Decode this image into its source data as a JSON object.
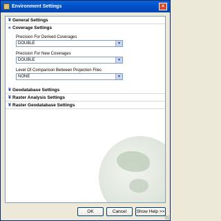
{
  "window": {
    "title": "Environment Settings",
    "close_glyph": "×"
  },
  "sections": [
    {
      "label": "General Settings",
      "expanded": false,
      "icon": "chevron-double-down-icon"
    },
    {
      "label": "Coverage Settings",
      "expanded": true,
      "icon": "chevron-double-up-icon"
    },
    {
      "label": "Geodatabase Settings",
      "expanded": false,
      "icon": "chevron-double-down-icon"
    },
    {
      "label": "Raster Analysis Settings",
      "expanded": false,
      "icon": "chevron-double-down-icon"
    },
    {
      "label": "Raster Geodatabase Settings",
      "expanded": false,
      "icon": "chevron-double-down-icon"
    }
  ],
  "coverage": {
    "precision_derived": {
      "label": "Precision For Derived Coverages",
      "value": "DOUBLE"
    },
    "precision_new": {
      "label": "Precision For New Coverages",
      "value": "DOUBLE"
    },
    "comparison": {
      "label": "Level Of Comparison Between Projection Files",
      "value": "NONE"
    }
  },
  "buttons": {
    "ok": "OK",
    "cancel": "Cancel",
    "help": "Show Help >>"
  },
  "glyphs": {
    "collapsed": "¥",
    "expanded": "«",
    "dropdown": "▼"
  }
}
